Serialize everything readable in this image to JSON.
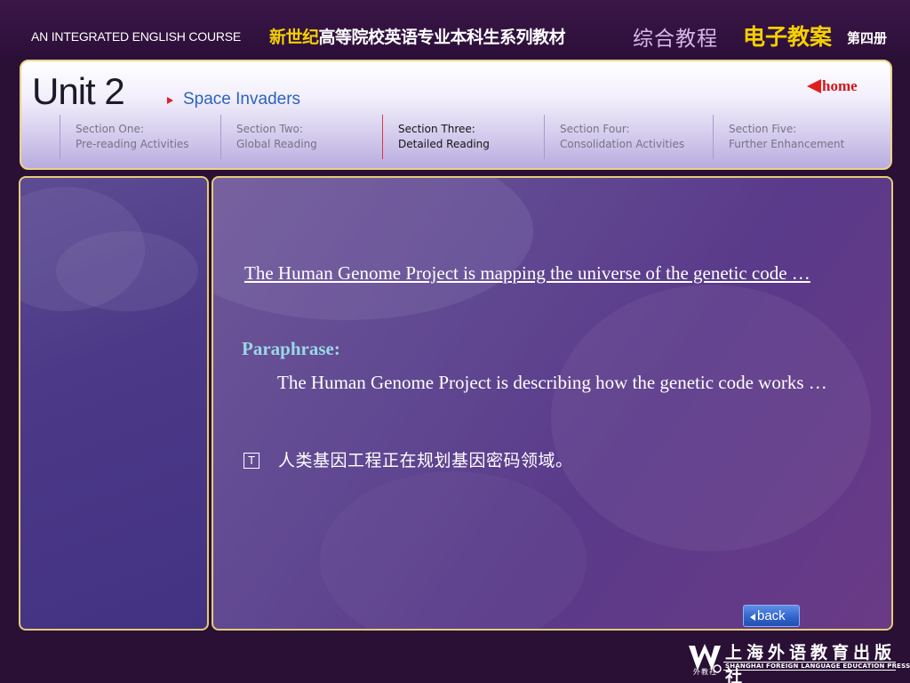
{
  "banner": {
    "course_name": "AN INTEGRATED ENGLISH COURSE",
    "series_highlight": "新世纪",
    "series_rest": "高等院校英语专业本科生系列教材",
    "comprehensive_course": "综合教程",
    "e_lesson": "电子教案",
    "volume": "第四册"
  },
  "header": {
    "unit_title": "Unit 2",
    "subtitle": "Space Invaders",
    "home_label": "home",
    "sections": [
      {
        "line1": "Section One:",
        "line2": "Pre-reading Activities",
        "active": false
      },
      {
        "line1": "Section Two:",
        "line2": "Global Reading",
        "active": false
      },
      {
        "line1": "Section Three:",
        "line2": "Detailed Reading",
        "active": true
      },
      {
        "line1": "Section Four:",
        "line2": "Consolidation Activities",
        "active": false
      },
      {
        "line1": "Section Five:",
        "line2": "Further Enhancement",
        "active": false
      }
    ]
  },
  "content": {
    "quote": "The Human Genome Project is mapping the universe of the genetic code …",
    "paraphrase_label": "Paraphrase:",
    "paraphrase": "The Human Genome Project is describing how the genetic code works …",
    "translation_button": "T",
    "translation": "人类基因工程正在规划基因密码领域。",
    "back_label": "back"
  },
  "footer": {
    "publisher_cn": "上海外语教育出版社",
    "publisher_en": "SHANGHAI FOREIGN LANGUAGE EDUCATION PRESS",
    "logo_under": "外教社"
  },
  "colors": {
    "frame": "#2a1035",
    "accent_yellow": "#f5d000",
    "panel_border": "#e3cc78",
    "home_red": "#d1171c",
    "paraphrase_label": "#99d8e4",
    "back_button": "#3365cc"
  }
}
